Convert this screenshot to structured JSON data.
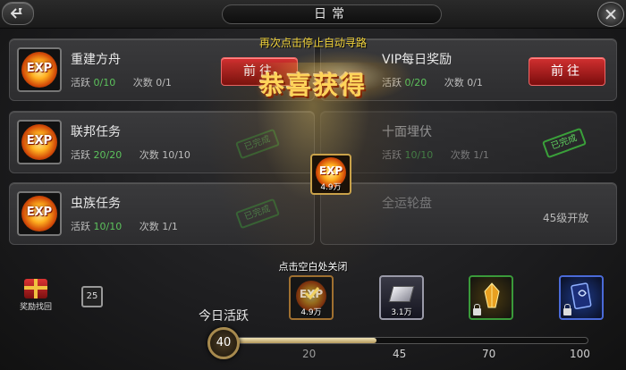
{
  "window": {
    "title": "日常"
  },
  "tasks": [
    {
      "name": "重建方舟",
      "activity_label": "活跃",
      "activity": "0/10",
      "count_label": "次数",
      "count": "0/1",
      "action": "前往"
    },
    {
      "name": "VIP每日奖励",
      "activity_label": "活跃",
      "activity": "0/20",
      "count_label": "次数",
      "count": "0/1",
      "action": "前往"
    },
    {
      "name": "联邦任务",
      "activity_label": "活跃",
      "activity": "20/20",
      "count_label": "次数",
      "count": "10/10",
      "stamp": "已完成"
    },
    {
      "name": "十面埋伏",
      "activity_label": "活跃",
      "activity": "10/10",
      "count_label": "次数",
      "count": "1/1",
      "stamp": "已完成"
    },
    {
      "name": "虫族任务",
      "activity_label": "活跃",
      "activity": "10/10",
      "count_label": "次数",
      "count": "1/1",
      "stamp": "已完成"
    },
    {
      "name": "全运轮盘",
      "status": "45级开放"
    }
  ],
  "bottom": {
    "reward_back_label": "奖励找回",
    "calendar_day": "25",
    "today_activity_label": "今日活跃",
    "current_activity": "40",
    "progress_fraction": 0.4,
    "milestones": [
      "20",
      "45",
      "70",
      "100"
    ],
    "rewards": [
      {
        "icon": "exp-icon",
        "label": "EXP",
        "amount": "4.9万"
      },
      {
        "icon": "metal-bar-icon",
        "amount": "3.1万",
        "locked": false
      },
      {
        "icon": "gold-crystal-icon",
        "locked": true
      },
      {
        "icon": "blue-card-icon",
        "locked": true
      }
    ]
  },
  "overlay": {
    "hint_top": "再次点击停止自动寻路",
    "title": "恭喜获得",
    "reward": {
      "label": "EXP",
      "amount": "4.9万"
    },
    "hint_bottom": "点击空白处关闭"
  },
  "colors": {
    "accent": "#ffd45a",
    "go_button": "#b01818",
    "done_green": "#5fd05f"
  }
}
